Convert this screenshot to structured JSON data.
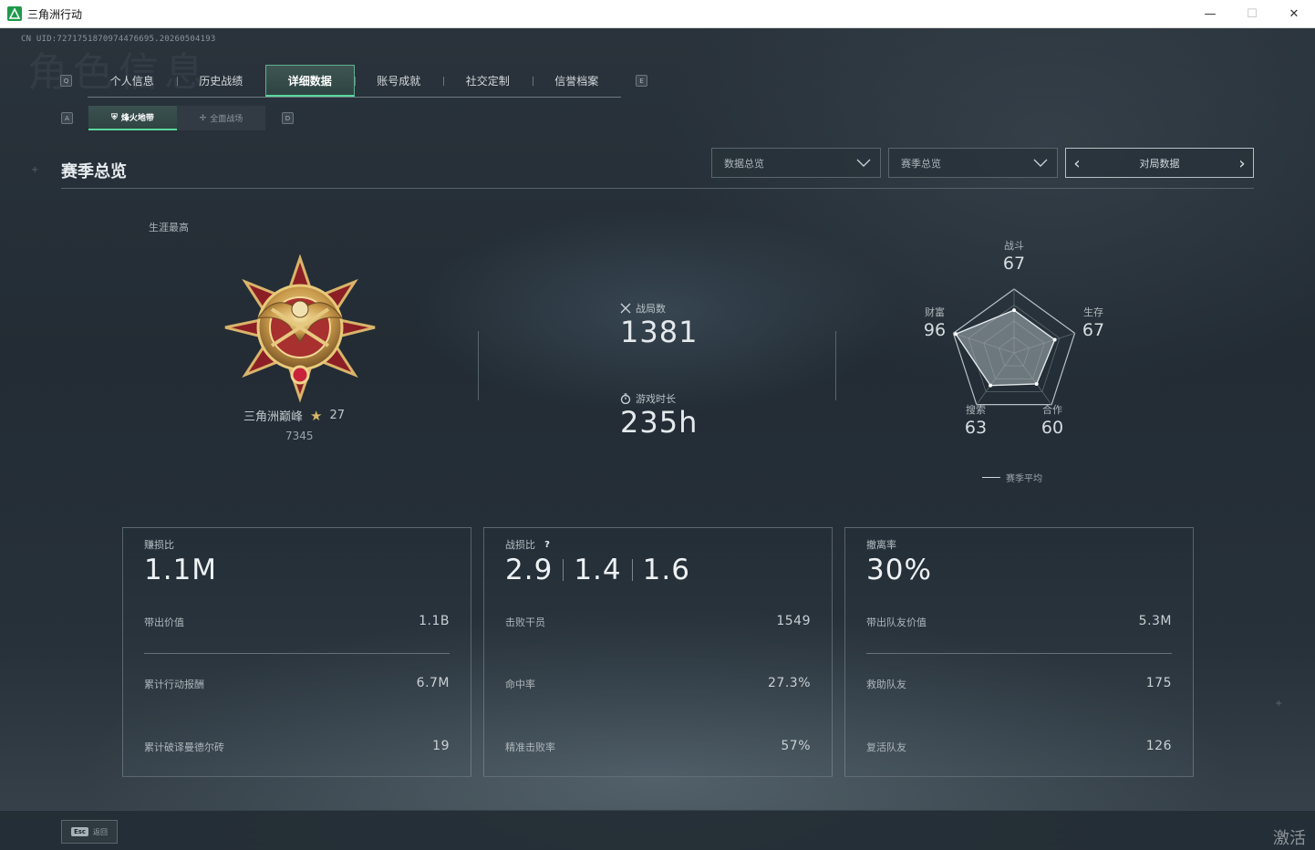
{
  "window": {
    "title": "三角洲行动",
    "controls": {
      "minimize": "—",
      "maximize": "☐",
      "close": "✕"
    }
  },
  "uid_text": "CN UID:7271751870974476695.20260504193",
  "ghost_text": "角色信息",
  "nav": {
    "key_left": "Q",
    "key_right": "E",
    "tabs": [
      {
        "label": "个人信息",
        "active": false
      },
      {
        "label": "历史战绩",
        "active": false
      },
      {
        "label": "详细数据",
        "active": true
      },
      {
        "label": "账号成就",
        "active": false
      },
      {
        "label": "社交定制",
        "active": false
      },
      {
        "label": "信誉档案",
        "active": false
      }
    ],
    "sub_key_left": "A",
    "sub_key_right": "D",
    "subtabs": [
      {
        "label": "烽火地带",
        "icon": "zone-icon",
        "active": true
      },
      {
        "label": "全面战场",
        "icon": "battlefield-icon",
        "active": false
      }
    ]
  },
  "header": {
    "title": "赛季总览",
    "dropdown1": "数据总览",
    "dropdown2": "赛季总览",
    "pager_label": "对局数据"
  },
  "rank": {
    "career_label": "生涯最高",
    "name": "三角洲巅峰",
    "stars": "27",
    "score": "7345"
  },
  "stats": {
    "matches_label": "战局数",
    "matches_value": "1381",
    "playtime_label": "游戏时长",
    "playtime_value": "235h"
  },
  "radar": {
    "axes": [
      {
        "label": "战斗",
        "value": "67"
      },
      {
        "label": "生存",
        "value": "67"
      },
      {
        "label": "合作",
        "value": "60"
      },
      {
        "label": "搜索",
        "value": "63"
      },
      {
        "label": "财富",
        "value": "96"
      }
    ],
    "values": [
      67,
      67,
      60,
      63,
      96
    ],
    "legend": "赛季平均"
  },
  "cards": [
    {
      "title": "赚损比",
      "main": "1.1M",
      "rows": [
        {
          "label": "带出价值",
          "value": "1.1B"
        },
        {
          "label": "累计行动报酬",
          "value": "6.7M"
        },
        {
          "label": "累计破译曼德尔砖",
          "value": "19"
        }
      ]
    },
    {
      "title": "战损比",
      "help": "?",
      "main_parts": [
        "2.9",
        "1.4",
        "1.6"
      ],
      "rows": [
        {
          "label": "击败干员",
          "value": "1549"
        },
        {
          "label": "命中率",
          "value": "27.3%"
        },
        {
          "label": "精准击败率",
          "value": "57%"
        }
      ]
    },
    {
      "title": "撤离率",
      "main": "30%",
      "rows": [
        {
          "label": "带出队友价值",
          "value": "5.3M"
        },
        {
          "label": "救助队友",
          "value": "175"
        },
        {
          "label": "复活队友",
          "value": "126"
        }
      ]
    }
  ],
  "footer": {
    "esc_key": "Esc",
    "back_label": "返回",
    "watermark": "激活"
  },
  "colors": {
    "accent_green": "#5ad79c",
    "gold": "#d8b66a",
    "medal_red": "#8b1f25"
  }
}
